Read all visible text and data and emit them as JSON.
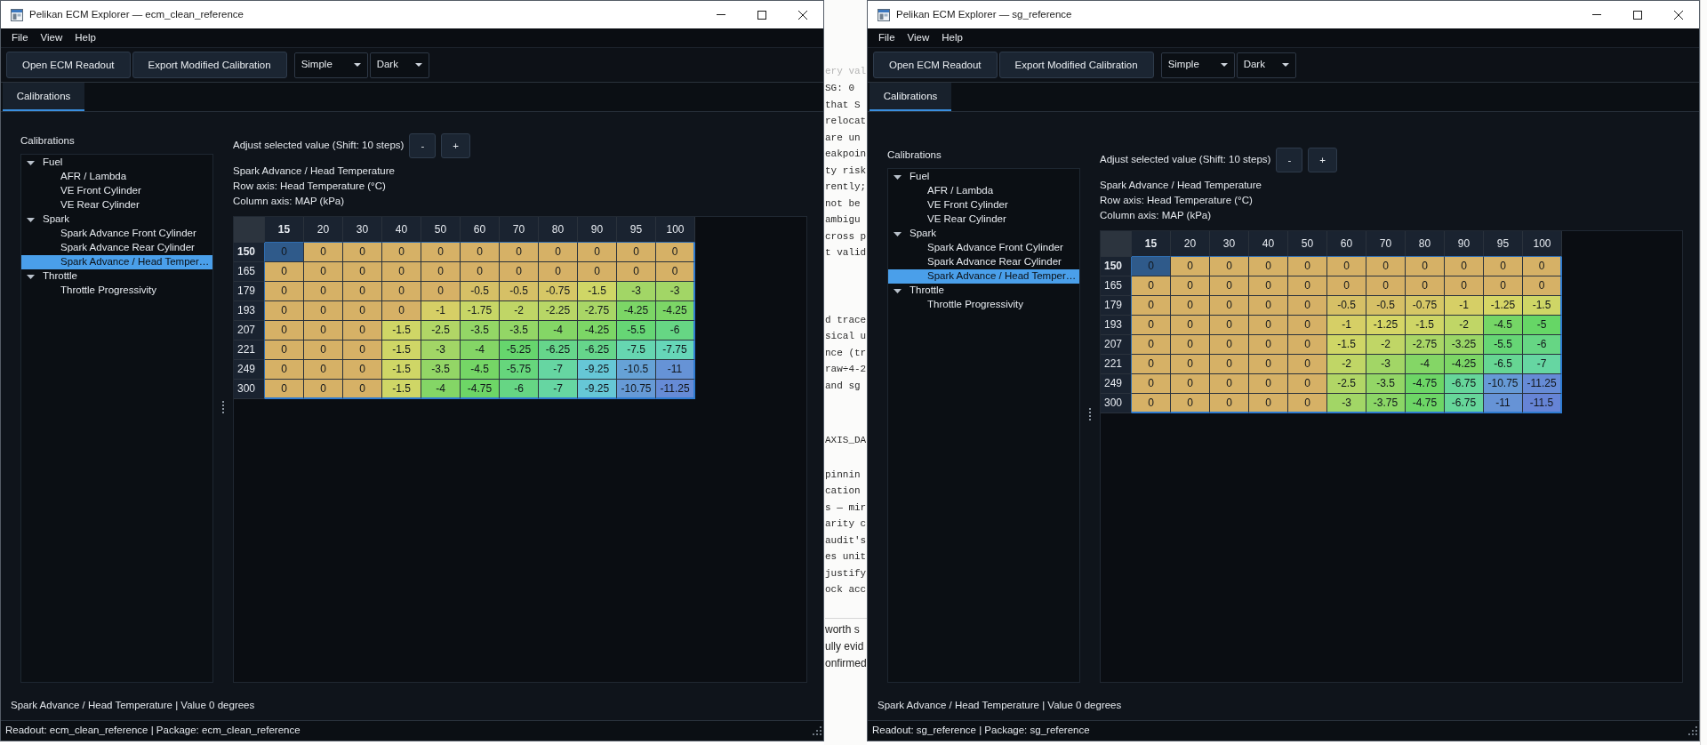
{
  "windows": [
    {
      "title": "Pelikan ECM Explorer — ecm_clean_reference",
      "menu_bar": [
        "File",
        "View",
        "Help"
      ],
      "toolbar": {
        "buttons": [
          "Open ECM Readout",
          "Export Modified Calibration"
        ],
        "dropdowns": [
          {
            "value": "Simple"
          },
          {
            "value": "Dark"
          }
        ]
      },
      "tabs": [
        {
          "label": "Calibrations",
          "selected": true
        }
      ],
      "tree": {
        "title": "Calibrations",
        "items": [
          {
            "label": "Fuel",
            "expanded": true,
            "selected": false,
            "children": [
              {
                "label": "AFR / Lambda",
                "selected": false
              },
              {
                "label": "VE Front Cylinder",
                "selected": false
              },
              {
                "label": "VE Rear Cylinder",
                "selected": false
              }
            ]
          },
          {
            "label": "Spark",
            "expanded": true,
            "selected": false,
            "children": [
              {
                "label": "Spark Advance Front Cylinder",
                "selected": false
              },
              {
                "label": "Spark Advance Rear Cylinder",
                "selected": false
              },
              {
                "label": "Spark Advance / Head Temper…",
                "selected": true
              }
            ]
          },
          {
            "label": "Throttle",
            "expanded": true,
            "selected": false,
            "children": [
              {
                "label": "Throttle Progressivity",
                "selected": false
              }
            ]
          }
        ]
      },
      "adjust": {
        "label": "Adjust selected value (Shift: 10 steps)",
        "buttons": [
          "-",
          "+"
        ]
      },
      "map": {
        "title": "Spark Advance / Head Temperature",
        "row_axis": "Row axis: Head Temperature (°C)",
        "column_axis": "Column axis: MAP (kPa)",
        "columns": [
          "15",
          "20",
          "30",
          "40",
          "50",
          "60",
          "70",
          "80",
          "90",
          "95",
          "100"
        ],
        "rows": [
          {
            "header": "150",
            "cells": [
              {
                "value": "0",
                "selected": true
              },
              {
                "value": "0",
                "selected": false
              },
              {
                "value": "0",
                "selected": false
              },
              {
                "value": "0",
                "selected": false
              },
              {
                "value": "0",
                "selected": false
              },
              {
                "value": "0",
                "selected": false
              },
              {
                "value": "0",
                "selected": false
              },
              {
                "value": "0",
                "selected": false
              },
              {
                "value": "0",
                "selected": false
              },
              {
                "value": "0",
                "selected": false
              },
              {
                "value": "0",
                "selected": false
              }
            ]
          },
          {
            "header": "165",
            "cells": [
              {
                "value": "0",
                "selected": false
              },
              {
                "value": "0",
                "selected": false
              },
              {
                "value": "0",
                "selected": false
              },
              {
                "value": "0",
                "selected": false
              },
              {
                "value": "0",
                "selected": false
              },
              {
                "value": "0",
                "selected": false
              },
              {
                "value": "0",
                "selected": false
              },
              {
                "value": "0",
                "selected": false
              },
              {
                "value": "0",
                "selected": false
              },
              {
                "value": "0",
                "selected": false
              },
              {
                "value": "0",
                "selected": false
              }
            ]
          },
          {
            "header": "179",
            "cells": [
              {
                "value": "0",
                "selected": false
              },
              {
                "value": "0",
                "selected": false
              },
              {
                "value": "0",
                "selected": false
              },
              {
                "value": "0",
                "selected": false
              },
              {
                "value": "0",
                "selected": false
              },
              {
                "value": "-0.5",
                "selected": false
              },
              {
                "value": "-0.5",
                "selected": false
              },
              {
                "value": "-0.75",
                "selected": false
              },
              {
                "value": "-1.5",
                "selected": false
              },
              {
                "value": "-3",
                "selected": false
              },
              {
                "value": "-3",
                "selected": false
              }
            ]
          },
          {
            "header": "193",
            "cells": [
              {
                "value": "0",
                "selected": false
              },
              {
                "value": "0",
                "selected": false
              },
              {
                "value": "0",
                "selected": false
              },
              {
                "value": "0",
                "selected": false
              },
              {
                "value": "-1",
                "selected": false
              },
              {
                "value": "-1.75",
                "selected": false
              },
              {
                "value": "-2",
                "selected": false
              },
              {
                "value": "-2.25",
                "selected": false
              },
              {
                "value": "-2.75",
                "selected": false
              },
              {
                "value": "-4.25",
                "selected": false
              },
              {
                "value": "-4.25",
                "selected": false
              }
            ]
          },
          {
            "header": "207",
            "cells": [
              {
                "value": "0",
                "selected": false
              },
              {
                "value": "0",
                "selected": false
              },
              {
                "value": "0",
                "selected": false
              },
              {
                "value": "-1.5",
                "selected": false
              },
              {
                "value": "-2.5",
                "selected": false
              },
              {
                "value": "-3.5",
                "selected": false
              },
              {
                "value": "-3.5",
                "selected": false
              },
              {
                "value": "-4",
                "selected": false
              },
              {
                "value": "-4.25",
                "selected": false
              },
              {
                "value": "-5.5",
                "selected": false
              },
              {
                "value": "-6",
                "selected": false
              }
            ]
          },
          {
            "header": "221",
            "cells": [
              {
                "value": "0",
                "selected": false
              },
              {
                "value": "0",
                "selected": false
              },
              {
                "value": "0",
                "selected": false
              },
              {
                "value": "-1.5",
                "selected": false
              },
              {
                "value": "-3",
                "selected": false
              },
              {
                "value": "-4",
                "selected": false
              },
              {
                "value": "-5.25",
                "selected": false
              },
              {
                "value": "-6.25",
                "selected": false
              },
              {
                "value": "-6.25",
                "selected": false
              },
              {
                "value": "-7.5",
                "selected": false
              },
              {
                "value": "-7.75",
                "selected": false
              }
            ]
          },
          {
            "header": "249",
            "cells": [
              {
                "value": "0",
                "selected": false
              },
              {
                "value": "0",
                "selected": false
              },
              {
                "value": "0",
                "selected": false
              },
              {
                "value": "-1.5",
                "selected": false
              },
              {
                "value": "-3.5",
                "selected": false
              },
              {
                "value": "-4.5",
                "selected": false
              },
              {
                "value": "-5.75",
                "selected": false
              },
              {
                "value": "-7",
                "selected": false
              },
              {
                "value": "-9.25",
                "selected": false
              },
              {
                "value": "-10.5",
                "selected": false
              },
              {
                "value": "-11",
                "selected": false
              }
            ]
          },
          {
            "header": "300",
            "cells": [
              {
                "value": "0",
                "selected": false
              },
              {
                "value": "0",
                "selected": false
              },
              {
                "value": "0",
                "selected": false
              },
              {
                "value": "-1.5",
                "selected": false
              },
              {
                "value": "-4",
                "selected": false
              },
              {
                "value": "-4.75",
                "selected": false
              },
              {
                "value": "-6",
                "selected": false
              },
              {
                "value": "-7",
                "selected": false
              },
              {
                "value": "-9.25",
                "selected": false
              },
              {
                "value": "-10.75",
                "selected": false
              },
              {
                "value": "-11.25",
                "selected": false
              }
            ]
          }
        ]
      },
      "status_label": "Spark Advance / Head Temperature | Value 0 degrees",
      "status_bar": "Readout: ecm_clean_reference | Package: ecm_clean_reference"
    },
    {
      "title": "Pelikan ECM Explorer — sg_reference",
      "menu_bar": [
        "File",
        "View",
        "Help"
      ],
      "toolbar": {
        "buttons": [
          "Open ECM Readout",
          "Export Modified Calibration"
        ],
        "dropdowns": [
          {
            "value": "Simple"
          },
          {
            "value": "Dark"
          }
        ]
      },
      "tabs": [
        {
          "label": "Calibrations",
          "selected": true
        }
      ],
      "tree": {
        "title": "Calibrations",
        "items": [
          {
            "label": "Fuel",
            "expanded": true,
            "selected": false,
            "children": [
              {
                "label": "AFR / Lambda",
                "selected": false
              },
              {
                "label": "VE Front Cylinder",
                "selected": false
              },
              {
                "label": "VE Rear Cylinder",
                "selected": false
              }
            ]
          },
          {
            "label": "Spark",
            "expanded": true,
            "selected": false,
            "children": [
              {
                "label": "Spark Advance Front Cylinder",
                "selected": false
              },
              {
                "label": "Spark Advance Rear Cylinder",
                "selected": false
              },
              {
                "label": "Spark Advance / Head Temper…",
                "selected": true
              }
            ]
          },
          {
            "label": "Throttle",
            "expanded": true,
            "selected": false,
            "children": [
              {
                "label": "Throttle Progressivity",
                "selected": false
              }
            ]
          }
        ]
      },
      "adjust": {
        "label": "Adjust selected value (Shift: 10 steps)",
        "buttons": [
          "-",
          "+"
        ]
      },
      "map": {
        "title": "Spark Advance / Head Temperature",
        "row_axis": "Row axis: Head Temperature (°C)",
        "column_axis": "Column axis: MAP (kPa)",
        "columns": [
          "15",
          "20",
          "30",
          "40",
          "50",
          "60",
          "70",
          "80",
          "90",
          "95",
          "100"
        ],
        "rows": [
          {
            "header": "150",
            "cells": [
              {
                "value": "0",
                "selected": true
              },
              {
                "value": "0",
                "selected": false
              },
              {
                "value": "0",
                "selected": false
              },
              {
                "value": "0",
                "selected": false
              },
              {
                "value": "0",
                "selected": false
              },
              {
                "value": "0",
                "selected": false
              },
              {
                "value": "0",
                "selected": false
              },
              {
                "value": "0",
                "selected": false
              },
              {
                "value": "0",
                "selected": false
              },
              {
                "value": "0",
                "selected": false
              },
              {
                "value": "0",
                "selected": false
              }
            ]
          },
          {
            "header": "165",
            "cells": [
              {
                "value": "0",
                "selected": false
              },
              {
                "value": "0",
                "selected": false
              },
              {
                "value": "0",
                "selected": false
              },
              {
                "value": "0",
                "selected": false
              },
              {
                "value": "0",
                "selected": false
              },
              {
                "value": "0",
                "selected": false
              },
              {
                "value": "0",
                "selected": false
              },
              {
                "value": "0",
                "selected": false
              },
              {
                "value": "0",
                "selected": false
              },
              {
                "value": "0",
                "selected": false
              },
              {
                "value": "0",
                "selected": false
              }
            ]
          },
          {
            "header": "179",
            "cells": [
              {
                "value": "0",
                "selected": false
              },
              {
                "value": "0",
                "selected": false
              },
              {
                "value": "0",
                "selected": false
              },
              {
                "value": "0",
                "selected": false
              },
              {
                "value": "0",
                "selected": false
              },
              {
                "value": "-0.5",
                "selected": false
              },
              {
                "value": "-0.5",
                "selected": false
              },
              {
                "value": "-0.75",
                "selected": false
              },
              {
                "value": "-1",
                "selected": false
              },
              {
                "value": "-1.25",
                "selected": false
              },
              {
                "value": "-1.5",
                "selected": false
              }
            ]
          },
          {
            "header": "193",
            "cells": [
              {
                "value": "0",
                "selected": false
              },
              {
                "value": "0",
                "selected": false
              },
              {
                "value": "0",
                "selected": false
              },
              {
                "value": "0",
                "selected": false
              },
              {
                "value": "0",
                "selected": false
              },
              {
                "value": "-1",
                "selected": false
              },
              {
                "value": "-1.25",
                "selected": false
              },
              {
                "value": "-1.5",
                "selected": false
              },
              {
                "value": "-2",
                "selected": false
              },
              {
                "value": "-4.5",
                "selected": false
              },
              {
                "value": "-5",
                "selected": false
              }
            ]
          },
          {
            "header": "207",
            "cells": [
              {
                "value": "0",
                "selected": false
              },
              {
                "value": "0",
                "selected": false
              },
              {
                "value": "0",
                "selected": false
              },
              {
                "value": "0",
                "selected": false
              },
              {
                "value": "0",
                "selected": false
              },
              {
                "value": "-1.5",
                "selected": false
              },
              {
                "value": "-2",
                "selected": false
              },
              {
                "value": "-2.75",
                "selected": false
              },
              {
                "value": "-3.25",
                "selected": false
              },
              {
                "value": "-5.5",
                "selected": false
              },
              {
                "value": "-6",
                "selected": false
              }
            ]
          },
          {
            "header": "221",
            "cells": [
              {
                "value": "0",
                "selected": false
              },
              {
                "value": "0",
                "selected": false
              },
              {
                "value": "0",
                "selected": false
              },
              {
                "value": "0",
                "selected": false
              },
              {
                "value": "0",
                "selected": false
              },
              {
                "value": "-2",
                "selected": false
              },
              {
                "value": "-3",
                "selected": false
              },
              {
                "value": "-4",
                "selected": false
              },
              {
                "value": "-4.25",
                "selected": false
              },
              {
                "value": "-6.5",
                "selected": false
              },
              {
                "value": "-7",
                "selected": false
              }
            ]
          },
          {
            "header": "249",
            "cells": [
              {
                "value": "0",
                "selected": false
              },
              {
                "value": "0",
                "selected": false
              },
              {
                "value": "0",
                "selected": false
              },
              {
                "value": "0",
                "selected": false
              },
              {
                "value": "0",
                "selected": false
              },
              {
                "value": "-2.5",
                "selected": false
              },
              {
                "value": "-3.5",
                "selected": false
              },
              {
                "value": "-4.75",
                "selected": false
              },
              {
                "value": "-6.75",
                "selected": false
              },
              {
                "value": "-10.75",
                "selected": false
              },
              {
                "value": "-11.25",
                "selected": false
              }
            ]
          },
          {
            "header": "300",
            "cells": [
              {
                "value": "0",
                "selected": false
              },
              {
                "value": "0",
                "selected": false
              },
              {
                "value": "0",
                "selected": false
              },
              {
                "value": "0",
                "selected": false
              },
              {
                "value": "0",
                "selected": false
              },
              {
                "value": "-3",
                "selected": false
              },
              {
                "value": "-3.75",
                "selected": false
              },
              {
                "value": "-4.75",
                "selected": false
              },
              {
                "value": "-6.75",
                "selected": false
              },
              {
                "value": "-11",
                "selected": false
              },
              {
                "value": "-11.5",
                "selected": false
              }
            ]
          }
        ]
      },
      "status_label": "Spark Advance / Head Temperature | Value 0 degrees",
      "status_bar": "Readout: sg_reference | Package: sg_reference"
    }
  ],
  "background_document": {
    "faded_line": "ery val",
    "paragraphs": [
      [
        "SG: 0",
        "that S",
        "relocat",
        "are un",
        "eakpoin",
        "ty risk",
        "rently;",
        "not be",
        "ambigu",
        "cross p",
        "t valid"
      ],
      [
        "d trace",
        "sical u",
        "nce (tr",
        "raw÷4-2",
        "and sg"
      ],
      [
        "AXIS_DA"
      ],
      [
        "pinnin",
        "cation",
        "s — mir",
        "arity c",
        "audit's",
        "es unit",
        "justify",
        "ock acc"
      ]
    ],
    "after_rule": [
      "worth s",
      "ully evid",
      "onfirmed"
    ]
  }
}
